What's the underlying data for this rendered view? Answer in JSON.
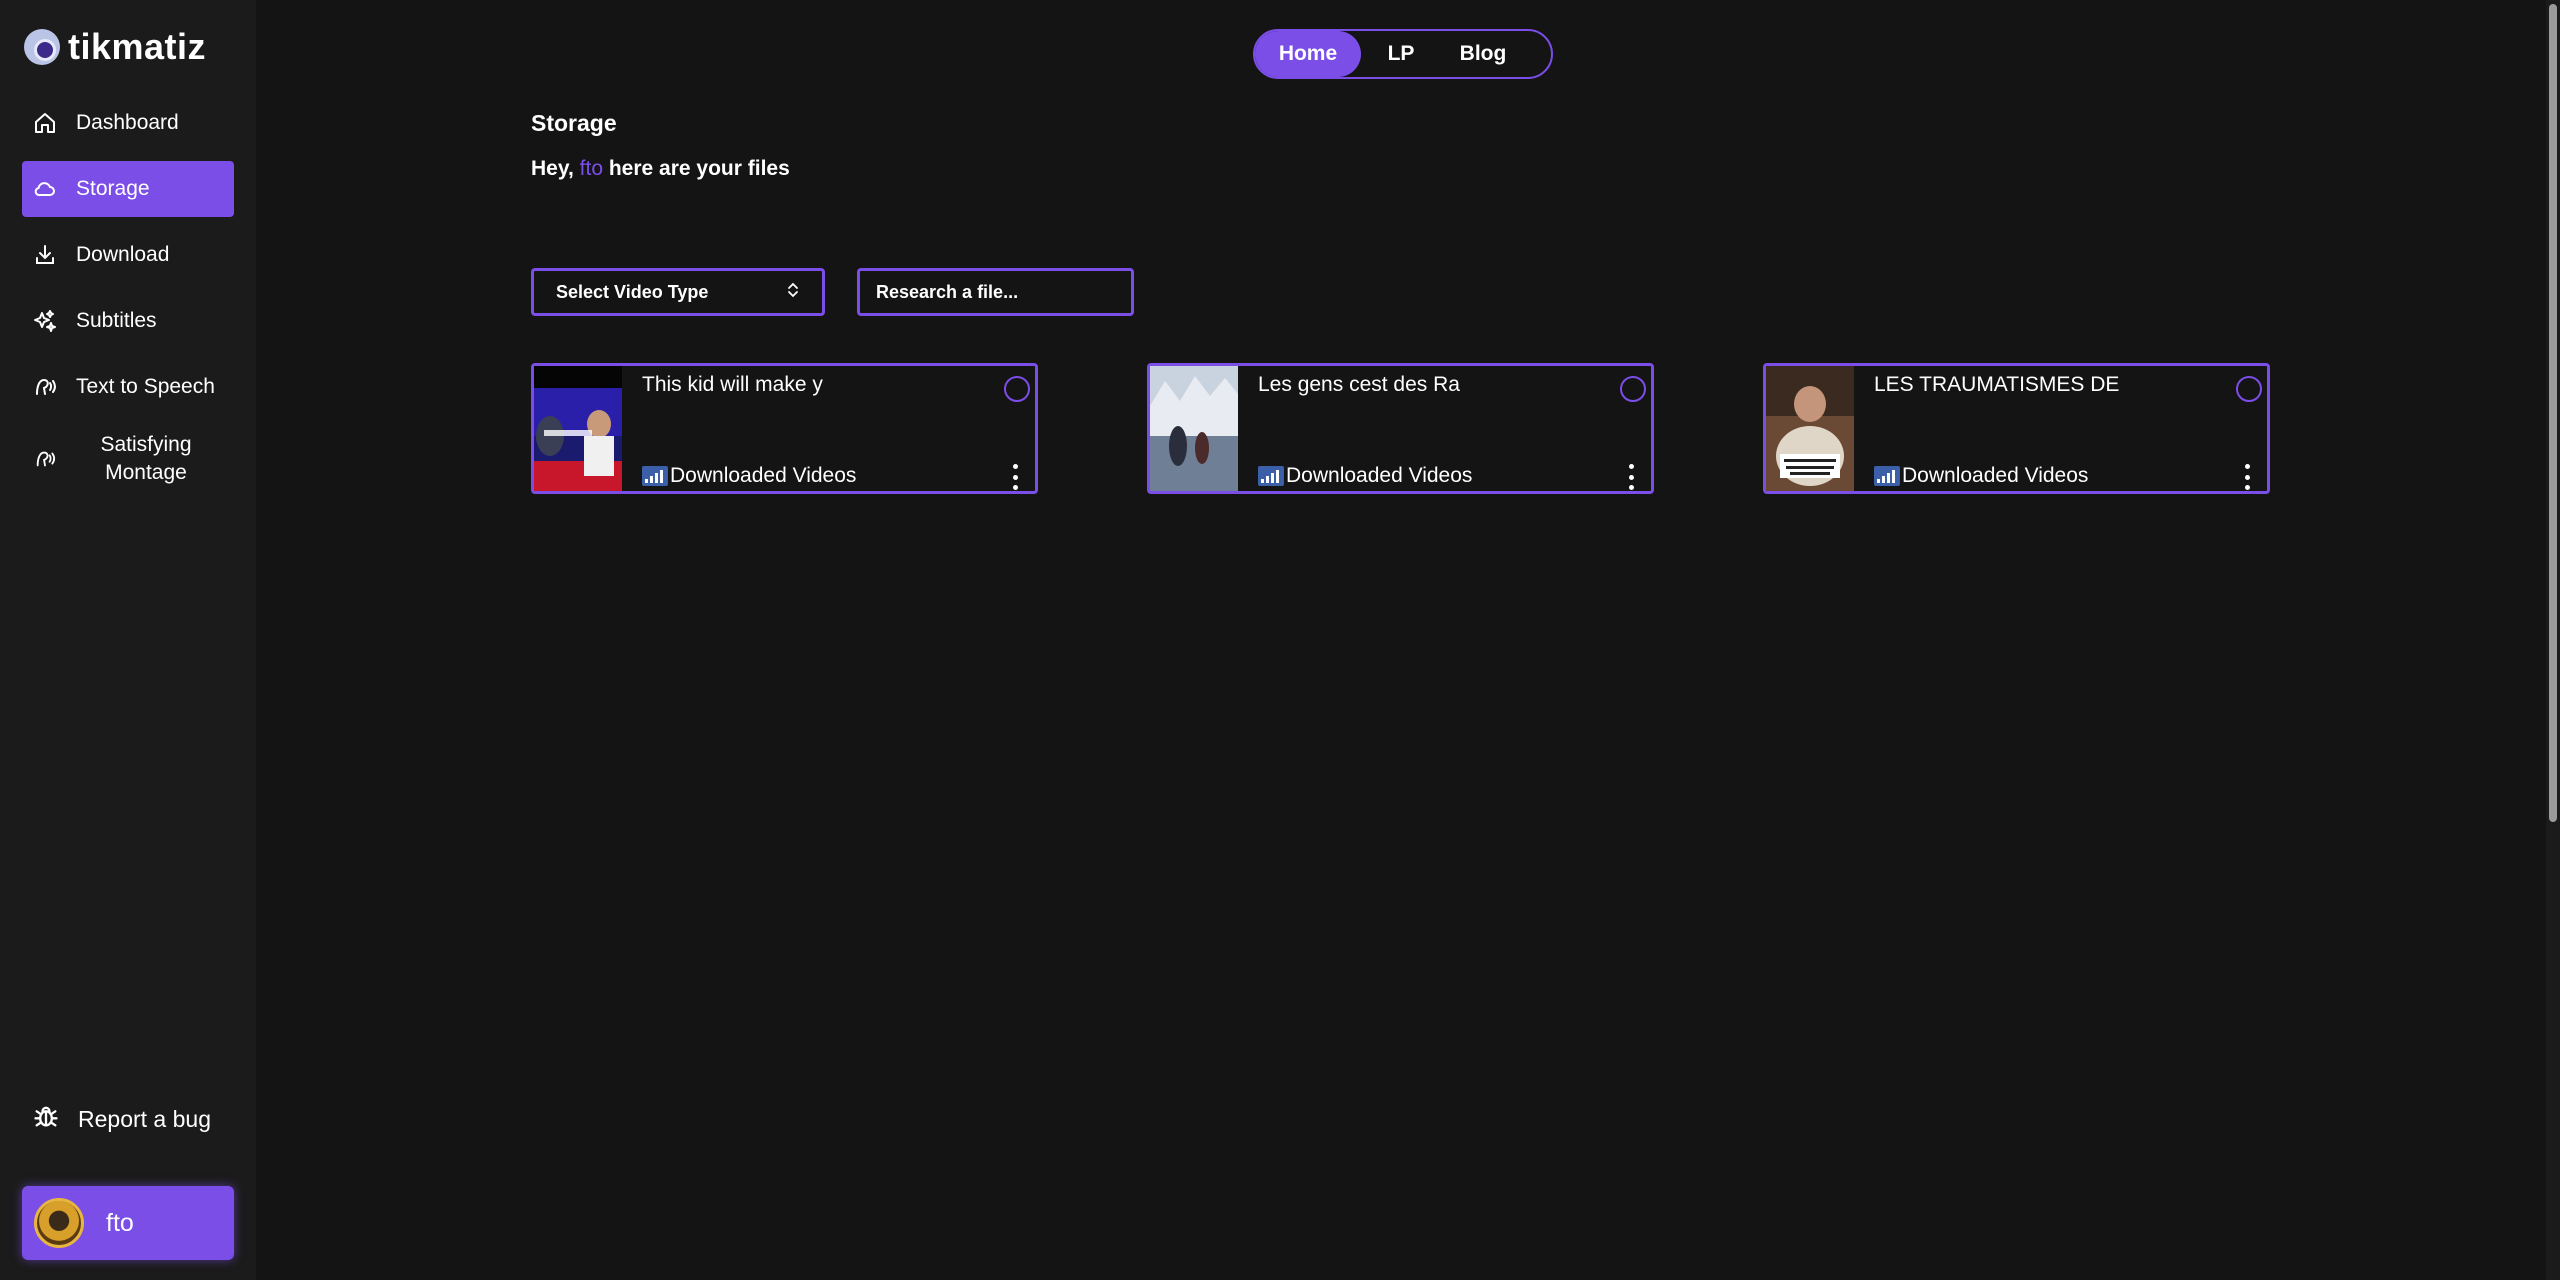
{
  "app": {
    "logo_text": "tikmatiz"
  },
  "sidebar": {
    "items": [
      {
        "label": "Dashboard",
        "icon": "home-icon"
      },
      {
        "label": "Storage",
        "icon": "cloud-icon",
        "active": true
      },
      {
        "label": "Download",
        "icon": "download-icon"
      },
      {
        "label": "Subtitles",
        "icon": "sparkle-icon"
      },
      {
        "label": "Text to Speech",
        "icon": "speech-icon"
      },
      {
        "label": "Satisfying Montage",
        "icon": "speech-icon"
      }
    ],
    "report_bug": "Report a bug",
    "user": {
      "name": "fto"
    }
  },
  "top_tabs": {
    "home": "Home",
    "lp": "LP",
    "blog": "Blog"
  },
  "main": {
    "title": "Storage",
    "greeting_prefix": "Hey,",
    "greeting_user": "fto",
    "greeting_suffix": "here are your files",
    "select_type_label": "Select Video Type",
    "search_placeholder": "Research a file..."
  },
  "files": [
    {
      "title": "This kid will make y",
      "folder": "Downloaded Videos"
    },
    {
      "title": "Les gens cest des Ra",
      "folder": "Downloaded Videos"
    },
    {
      "title": "LES TRAUMATISMES DE",
      "folder": "Downloaded Videos"
    }
  ],
  "colors": {
    "accent": "#7b4ee8",
    "background": "#141414",
    "sidebar": "#1b1b1b"
  }
}
